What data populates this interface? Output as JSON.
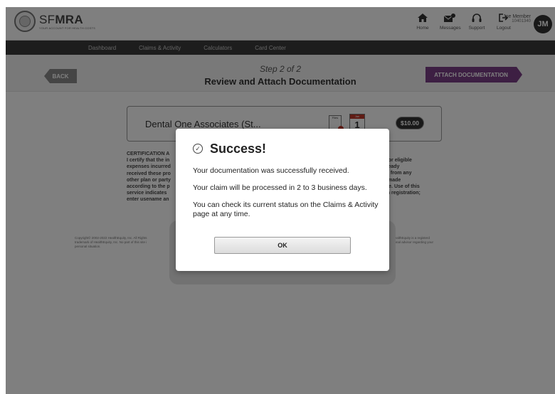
{
  "header": {
    "logo_title_light": "SF",
    "logo_title_bold": "MRA",
    "logo_tagline": "YOUR ACCOUNT FOR HEALTH COSTS",
    "nav": [
      {
        "label": "Home",
        "icon": "home-icon"
      },
      {
        "label": "Messages",
        "icon": "messages-icon"
      },
      {
        "label": "Support",
        "icon": "support-headset-icon"
      },
      {
        "label": "Logout",
        "icon": "logout-icon"
      }
    ],
    "user_name": "Joe Member",
    "user_id": "10401340",
    "avatar_initials": "JM"
  },
  "main_nav": [
    "Dashboard",
    "Claims & Activity",
    "Calculators",
    "Card Center"
  ],
  "step": {
    "back_label": "BACK",
    "step_number": "Step 2 of 2",
    "title": "Review and Attach Documentation",
    "attach_label": "ATTACH DOCUMENTATION",
    "attach_color": "#7b3f87"
  },
  "claim": {
    "provider": "Dental One Associates (St...",
    "files_label": "Files",
    "calendar_month": "Jan",
    "calendar_day": "1",
    "amount": "$10.00"
  },
  "certification": {
    "heading_visible": "CERTIFICATION A",
    "left_lines": [
      "I certify that the in",
      "expenses incurred",
      "received these pro",
      "other plan or party",
      "according to the p",
      "service indicates",
      "enter usename an"
    ],
    "right_lines": [
      "ent for eligible",
      "e already",
      "ense from any",
      "l be made",
      "b Site. Use of this",
      "upon registration;"
    ]
  },
  "footer": {
    "left_lines": [
      "Copyright© 2002-2022 HealthEquity, Inc. All Rights",
      "trademark of HealthEquity, Inc. No part of this site i",
      "personal situation."
    ],
    "right_lines": [
      "rotected by other laws. HealthEquity is a registerd",
      "should consult a professional advisor regarding your"
    ]
  },
  "modal": {
    "title": "Success!",
    "icon": "check-circle-icon",
    "paragraphs": [
      "Your documentation was successfully received.",
      "Your claim will be processed in 2 to 3 business days.",
      "You can check its current status on the Claims & Activity page at any time."
    ],
    "ok_label": "OK"
  }
}
